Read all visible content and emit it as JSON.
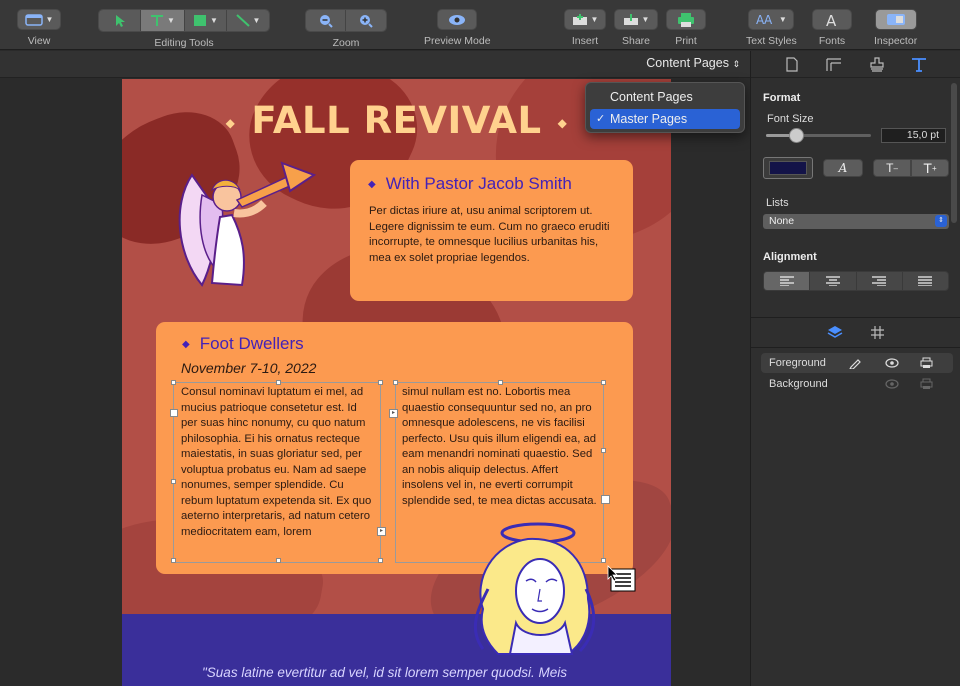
{
  "toolbar": {
    "view_label": "View",
    "editing_tools_label": "Editing Tools",
    "zoom_label": "Zoom",
    "preview_label": "Preview Mode",
    "insert_label": "Insert",
    "share_label": "Share",
    "print_label": "Print",
    "text_styles_label": "Text Styles",
    "fonts_label": "Fonts",
    "inspector_label": "Inspector"
  },
  "view_switch": {
    "label": "Content Pages"
  },
  "dropdown": {
    "items": [
      {
        "label": "Content Pages",
        "checked": false
      },
      {
        "label": "Master Pages",
        "checked": true
      }
    ],
    "check_glyph": "✓"
  },
  "document": {
    "title": "FALL REVIVAL",
    "card1": {
      "heading": "With Pastor Jacob Smith",
      "body": "Per dictas iriure at, usu animal scriptorem ut. Legere dignissim te eum. Cum no graeco eruditi incorrupte, te omnesque lucilius urbanitas his, mea ex solet propriae legendos."
    },
    "card2": {
      "heading": "Foot Dwellers",
      "date": "November 7-10, 2022",
      "col1": "Consul nominavi luptatum ei mel, ad mucius patrioque consetetur est. Id per suas hinc nonumy, cu quo natum philosophia. Ei his ornatus recteque maiestatis, in suas gloriatur sed, per voluptua probatus eu. Nam ad saepe nonumes, semper splendide.  Cu rebum luptatum expetenda sit. Ex quo aeterno interpretaris, ad natum cetero mediocritatem eam, lorem",
      "col2": "simul nullam est no. Lobortis mea quaestio consequuntur sed no, an pro omnesque adolescens, ne vis facilisi perfecto. Usu quis illum eligendi ea, ad eam menandri nominati quaestio. Sed an nobis aliquip delectus. Affert insolens vel in, ne everti corrumpit splendide sed, te mea dictas accusata."
    },
    "quote": "\"Suas latine evertitur ad vel, id sit lorem semper quodsi. Meis"
  },
  "inspector": {
    "format_title": "Format",
    "font_size_label": "Font Size",
    "font_size_value": "15,0 pt",
    "font_size_fraction": 0.3,
    "lists_label": "Lists",
    "lists_value": "None",
    "alignment_title": "Alignment",
    "italic_glyph": "A",
    "shrink_glyph": "T",
    "grow_glyph": "T",
    "layers": [
      {
        "label": "Foreground"
      },
      {
        "label": "Background"
      }
    ]
  },
  "colors": {
    "accent": "#2a62d5",
    "page_background": "#b24f47",
    "card": "#fc9a50",
    "title": "#ffd28e",
    "heading": "#4322b8",
    "footer_band": "#3a2f9a",
    "text_color_well": "#131348"
  },
  "icons": [
    "view-icon",
    "pointer-icon",
    "text-tool-icon",
    "shape-tool-icon",
    "line-tool-icon",
    "zoom-out-icon",
    "zoom-in-icon",
    "eye-icon",
    "insert-icon",
    "share-icon",
    "printer-icon",
    "text-styles-icon",
    "fonts-icon",
    "inspector-icon",
    "document-icon",
    "layout-icon",
    "stamp-icon",
    "text-format-icon",
    "layers-icon",
    "grid-icon",
    "pencil-icon"
  ]
}
